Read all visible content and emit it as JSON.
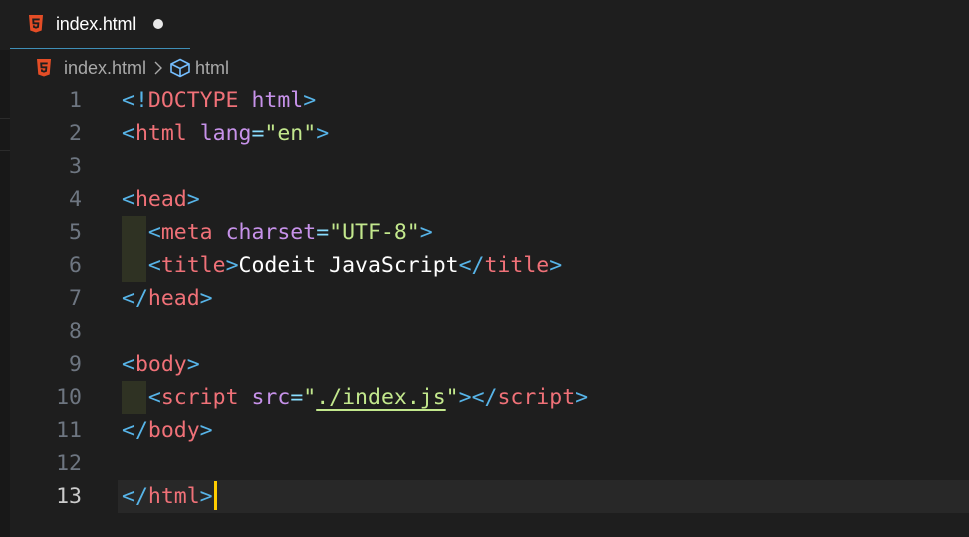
{
  "tab": {
    "icon": "html5-icon",
    "label": "index.html",
    "modified": true
  },
  "breadcrumb": {
    "file": "index.html",
    "symbol_icon": "cube-icon",
    "symbol": "html"
  },
  "editor": {
    "current_line": 13,
    "lines": [
      {
        "num": "1",
        "tokens": [
          [
            "br",
            "<!"
          ],
          [
            "tag",
            "DOCTYPE"
          ],
          [
            "txt",
            " "
          ],
          [
            "attr",
            "html"
          ],
          [
            "br",
            ">"
          ]
        ]
      },
      {
        "num": "2",
        "tokens": [
          [
            "br",
            "<"
          ],
          [
            "tag",
            "html"
          ],
          [
            "txt",
            " "
          ],
          [
            "attr",
            "lang"
          ],
          [
            "eq",
            "="
          ],
          [
            "str",
            "\"en\""
          ],
          [
            "br",
            ">"
          ]
        ]
      },
      {
        "num": "3",
        "tokens": []
      },
      {
        "num": "4",
        "tokens": [
          [
            "br",
            "<"
          ],
          [
            "tag",
            "head"
          ],
          [
            "br",
            ">"
          ]
        ]
      },
      {
        "num": "5",
        "indent": true,
        "tokens": [
          [
            "txt",
            "  "
          ],
          [
            "br",
            "<"
          ],
          [
            "tag",
            "meta"
          ],
          [
            "txt",
            " "
          ],
          [
            "attr",
            "charset"
          ],
          [
            "eq",
            "="
          ],
          [
            "str",
            "\"UTF-8\""
          ],
          [
            "br",
            ">"
          ]
        ]
      },
      {
        "num": "6",
        "indent": true,
        "tokens": [
          [
            "txt",
            "  "
          ],
          [
            "br",
            "<"
          ],
          [
            "tag",
            "title"
          ],
          [
            "br",
            ">"
          ],
          [
            "txt",
            "Codeit JavaScript"
          ],
          [
            "br",
            "</"
          ],
          [
            "tag",
            "title"
          ],
          [
            "br",
            ">"
          ]
        ]
      },
      {
        "num": "7",
        "tokens": [
          [
            "br",
            "</"
          ],
          [
            "tag",
            "head"
          ],
          [
            "br",
            ">"
          ]
        ]
      },
      {
        "num": "8",
        "tokens": []
      },
      {
        "num": "9",
        "tokens": [
          [
            "br",
            "<"
          ],
          [
            "tag",
            "body"
          ],
          [
            "br",
            ">"
          ]
        ]
      },
      {
        "num": "10",
        "indent": true,
        "tokens": [
          [
            "txt",
            "  "
          ],
          [
            "br",
            "<"
          ],
          [
            "tag",
            "script"
          ],
          [
            "txt",
            " "
          ],
          [
            "attr",
            "src"
          ],
          [
            "eq",
            "="
          ],
          [
            "str",
            "\""
          ],
          [
            "link",
            "./index.js"
          ],
          [
            "str",
            "\""
          ],
          [
            "br",
            "></"
          ],
          [
            "tag",
            "script"
          ],
          [
            "br",
            ">"
          ]
        ]
      },
      {
        "num": "11",
        "tokens": [
          [
            "br",
            "</"
          ],
          [
            "tag",
            "body"
          ],
          [
            "br",
            ">"
          ]
        ]
      },
      {
        "num": "12",
        "tokens": []
      },
      {
        "num": "13",
        "tokens": [
          [
            "br",
            "</"
          ],
          [
            "tag",
            "html"
          ],
          [
            "br",
            ">"
          ]
        ],
        "cursor": true
      }
    ]
  }
}
